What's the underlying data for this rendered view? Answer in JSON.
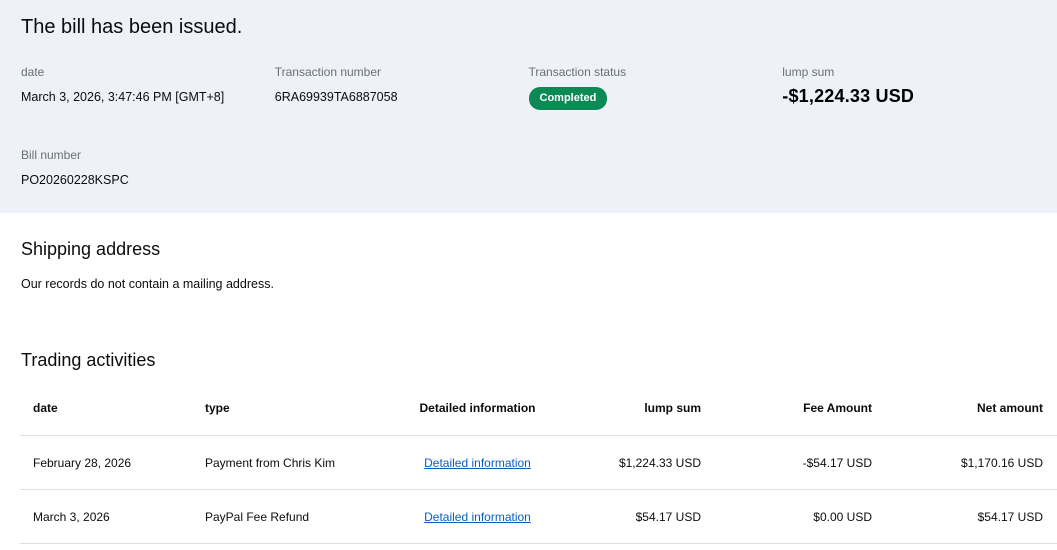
{
  "colors": {
    "hero_background": "#eef1f8",
    "status_badge_green": "#0c8a56",
    "link_blue": "#0b5dc2",
    "label_gray": "#687173",
    "row_border_gray": "#dcdee0"
  },
  "hero": {
    "title": "The bill has been issued.",
    "fields": [
      {
        "label": "date",
        "value": "March 3, 2026, 3:47:46 PM [GMT+8]"
      },
      {
        "label": "Transaction number",
        "value": "6RA69939TA6887058"
      },
      {
        "label": "Transaction status",
        "value": "Completed"
      },
      {
        "label": "lump sum",
        "value": "-$1,224.33 USD"
      },
      {
        "label": "Bill number",
        "value": "PO20260228KSPC"
      }
    ]
  },
  "shipping": {
    "heading": "Shipping address",
    "message": "Our records do not contain a mailing address."
  },
  "activities": {
    "heading": "Trading activities",
    "columns": [
      "date",
      "type",
      "Detailed information",
      "lump sum",
      "Fee Amount",
      "Net amount"
    ],
    "rows": [
      {
        "date": "February 28, 2026",
        "type": "Payment from Chris Kim",
        "detail_link": "Detailed information",
        "lump_sum": "$1,224.33 USD",
        "fee": "-$54.17 USD",
        "net": "$1,170.16 USD"
      },
      {
        "date": "March 3, 2026",
        "type": "PayPal Fee Refund",
        "detail_link": "Detailed information",
        "lump_sum": "$54.17 USD",
        "fee": "$0.00 USD",
        "net": "$54.17 USD"
      }
    ]
  }
}
